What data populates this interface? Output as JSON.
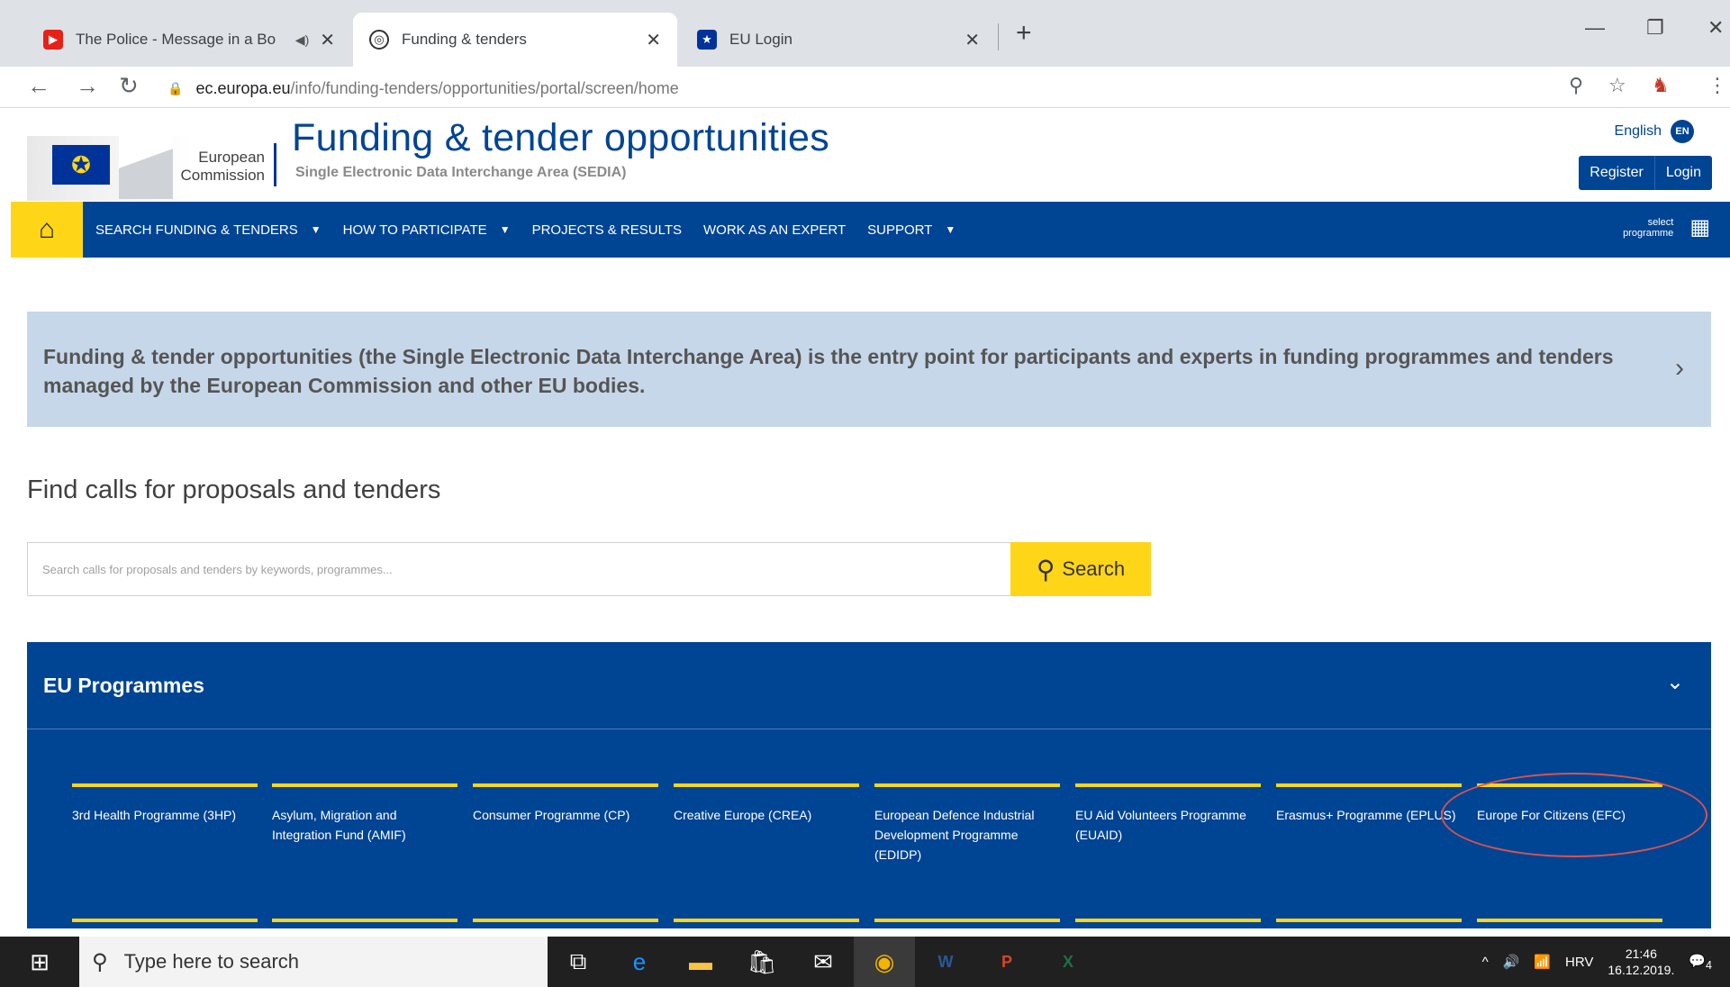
{
  "browser": {
    "tabs": [
      {
        "title": "The Police - Message in a Bo",
        "icon": "youtube-icon"
      },
      {
        "title": "Funding & tenders",
        "icon": "globe-icon"
      },
      {
        "title": "EU Login",
        "icon": "eu-flag-icon"
      }
    ],
    "url_host": "ec.europa.eu",
    "url_path": "/info/funding-tenders/opportunities/portal/screen/home"
  },
  "header": {
    "logo_line1": "European",
    "logo_line2": "Commission",
    "title": "Funding & tender opportunities",
    "subtitle": "Single Electronic Data Interchange Area (SEDIA)",
    "language": "English",
    "language_code": "EN",
    "register": "Register",
    "login": "Login"
  },
  "nav": {
    "items": [
      {
        "label": "SEARCH FUNDING & TENDERS",
        "dropdown": true
      },
      {
        "label": "HOW TO PARTICIPATE",
        "dropdown": true
      },
      {
        "label": "PROJECTS & RESULTS",
        "dropdown": false
      },
      {
        "label": "WORK AS AN EXPERT",
        "dropdown": false
      },
      {
        "label": "SUPPORT",
        "dropdown": true
      }
    ],
    "select_line1": "select",
    "select_line2": "programme"
  },
  "intro": {
    "text": "Funding & tender opportunities (the Single Electronic Data Interchange Area) is the entry point for participants and experts in funding programmes and tenders managed by the European Commission and other EU bodies."
  },
  "find": {
    "title": "Find calls for proposals and tenders",
    "placeholder": "Search calls for proposals and tenders by keywords, programmes...",
    "button": "Search"
  },
  "programmes": {
    "title": "EU Programmes",
    "items": [
      "3rd Health Programme (3HP)",
      "Asylum, Migration and Integration Fund (AMIF)",
      "Consumer Programme (CP)",
      "Creative Europe (CREA)",
      "European Defence Industrial Development Programme (EDIDP)",
      "EU Aid Volunteers Programme (EUAID)",
      "Erasmus+ Programme (EPLUS)",
      "Europe For Citizens (EFC)"
    ]
  },
  "taskbar": {
    "search_placeholder": "Type here to search",
    "language": "HRV",
    "time": "21:46",
    "date": "16.12.2019.",
    "notifications": "4"
  },
  "colors": {
    "eu_blue": "#004494",
    "eu_yellow": "#ffd617",
    "intro_bg": "#c7d7ea"
  }
}
